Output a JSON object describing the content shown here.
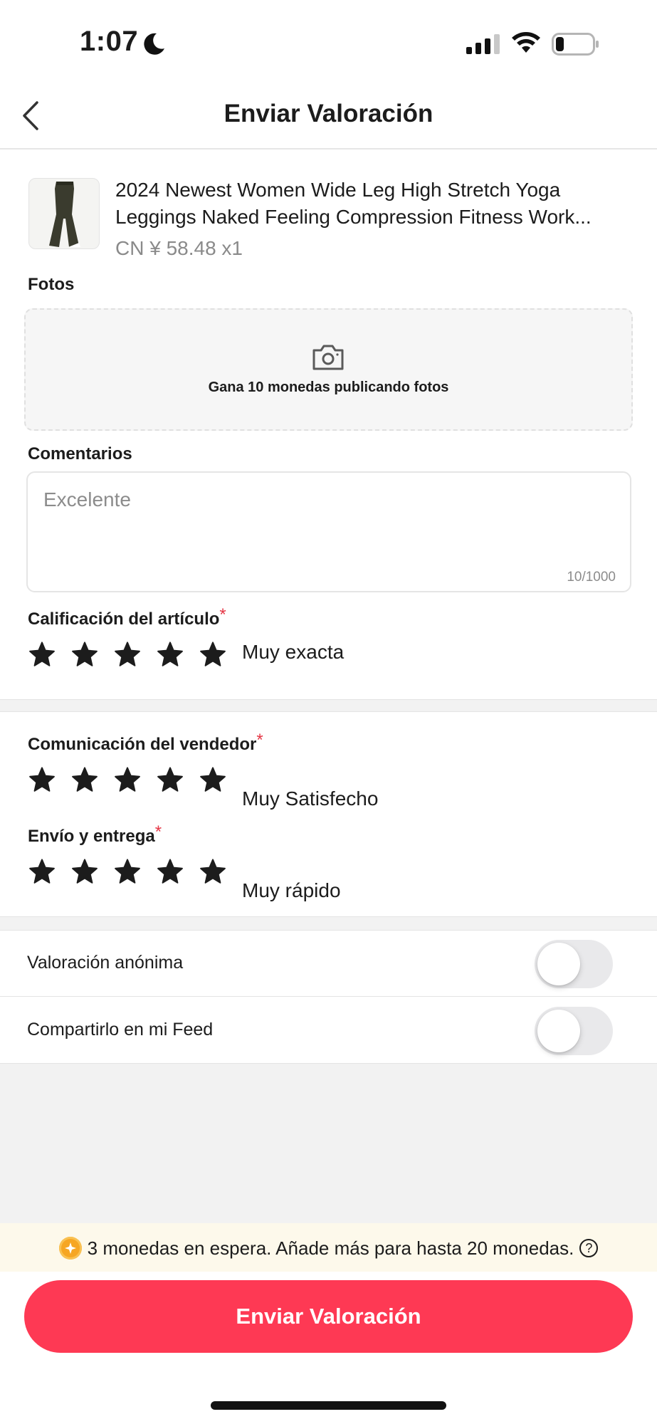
{
  "status_bar": {
    "time": "1:07",
    "icons": [
      "moon-icon",
      "cellular-signal-icon",
      "wifi-icon",
      "battery-icon"
    ]
  },
  "header": {
    "title": "Enviar Valoración",
    "back_icon": "chevron-left-icon"
  },
  "product": {
    "name_line1": "2024 Newest Women Wide Leg High Stretch Yoga",
    "name_line2": "Leggings Naked Feeling Compression Fitness Work...",
    "price": "CN ¥  58.48 x1"
  },
  "photos": {
    "label": "Fotos",
    "upload_text": "Gana 10 monedas publicando fotos",
    "icon": "camera-icon"
  },
  "comments": {
    "label": "Comentarios",
    "value": "",
    "placeholder": "Excelente",
    "counter": "10/1000"
  },
  "ratings": [
    {
      "label": "Calificación del artículo",
      "required_mark": "*",
      "stars": 5,
      "max": 5,
      "value_text": "Muy exacta"
    },
    {
      "label": "Comunicación del vendedor",
      "required_mark": "*",
      "stars": 5,
      "max": 5,
      "value_text": "Muy Satisfecho"
    },
    {
      "label": "Envío y entrega",
      "required_mark": "*",
      "stars": 5,
      "max": 5,
      "value_text": "Muy rápido"
    }
  ],
  "toggles": [
    {
      "label": "Valoración anónima",
      "on": false
    },
    {
      "label": "Compartirlo en mi Feed",
      "on": false
    }
  ],
  "coins_banner": {
    "text": "3 monedas en espera. Añade más para hasta 20 monedas.",
    "help_symbol": "?"
  },
  "submit_button": {
    "label": "Enviar Valoración"
  },
  "colors": {
    "accent": "#fe3954",
    "required": "#e53645",
    "star": "#1c1c1c",
    "coin": "#f6a623",
    "banner_bg": "#fdf9eb",
    "band_bg": "#f2f2f2"
  }
}
